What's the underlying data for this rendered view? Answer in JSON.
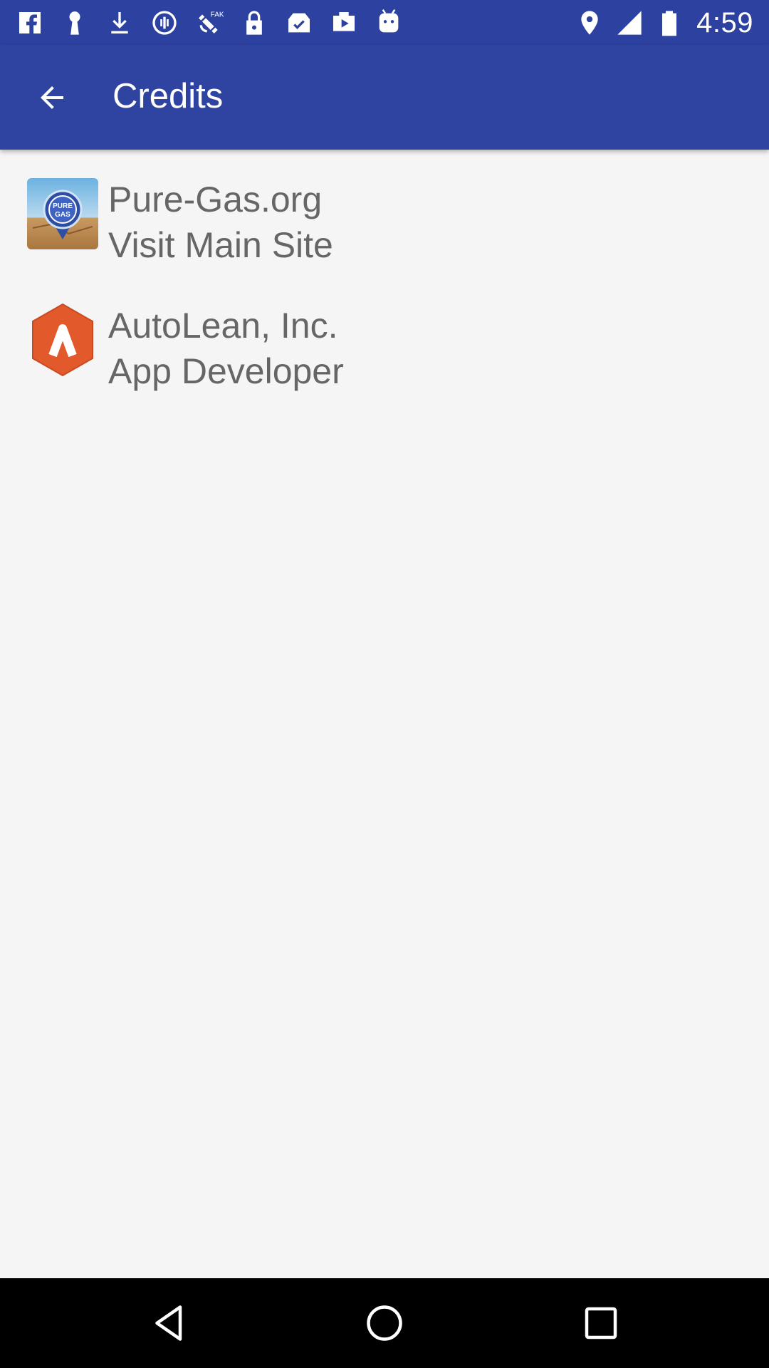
{
  "status_bar": {
    "time": "4:59",
    "left_icons": [
      "fb-lite-icon",
      "keyhole-icon",
      "download-icon",
      "data-saver-icon",
      "fake-gps-icon",
      "lock-icon",
      "clipboard-check-icon",
      "youtube-icon",
      "android-icon"
    ],
    "right_icons": [
      "location-icon",
      "signal-icon",
      "battery-icon"
    ]
  },
  "app_bar": {
    "title": "Credits",
    "background": "#2f44a1"
  },
  "credits": [
    {
      "name": "Pure-Gas.org",
      "role": "Visit Main Site",
      "icon": "pure-gas-logo-icon",
      "icon_text": "PURE GAS"
    },
    {
      "name": "AutoLean, Inc.",
      "role": "App Developer",
      "icon": "autolean-logo-icon"
    }
  ],
  "nav_bar": {
    "icons": [
      "back-triangle-icon",
      "home-circle-icon",
      "recents-square-icon"
    ]
  }
}
